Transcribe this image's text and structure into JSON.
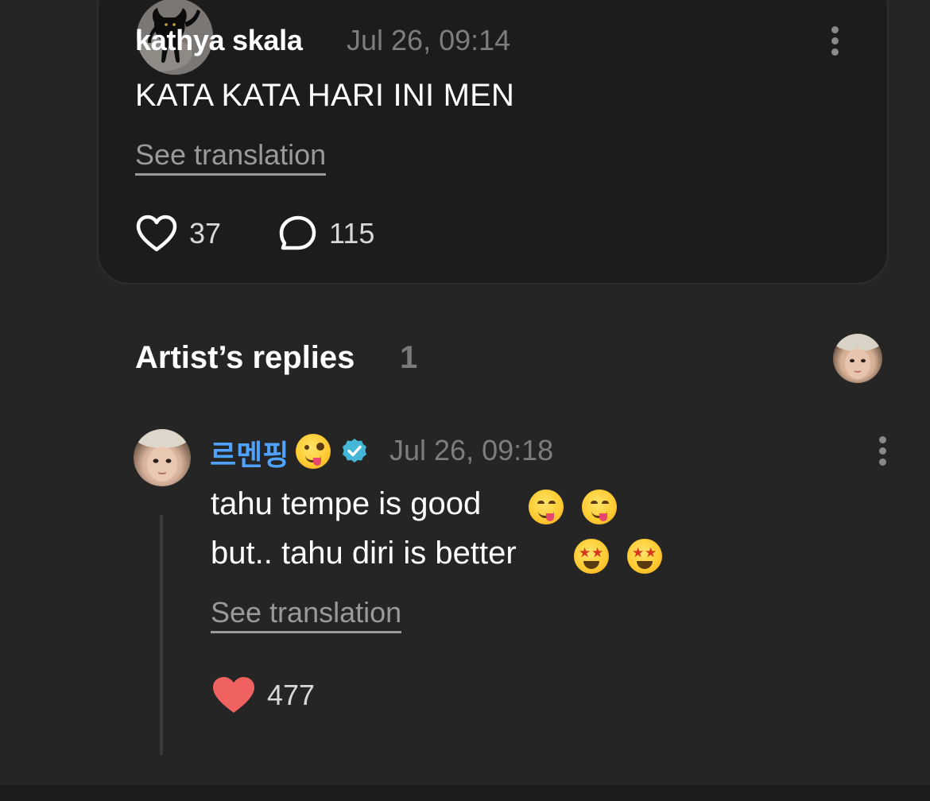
{
  "post": {
    "author": "kathya skala",
    "timestamp": "Jul 26, 09:14",
    "text": "KATA KATA HARI INI MEN",
    "see_translation": "See translation",
    "likes": "37",
    "comments": "115"
  },
  "artist_replies": {
    "title": "Artist’s replies",
    "count": "1"
  },
  "reply": {
    "author": "르멘핑",
    "timestamp": "Jul 26, 09:18",
    "line1": "tahu tempe is good",
    "line2": "but.. tahu diri is better",
    "see_translation": "See translation",
    "likes": "477"
  },
  "colors": {
    "background": "#252525",
    "card": "#1c1c1c",
    "artist_name": "#4fa3ff",
    "verified": "#44b7d6",
    "liked_heart": "#f0625f",
    "muted_text": "#7d7d7d"
  },
  "icons": {
    "like": "heart-outline-icon",
    "comment": "speech-bubble-icon",
    "liked": "heart-filled-icon",
    "more": "more-vertical-icon",
    "verified": "verified-badge-icon"
  }
}
